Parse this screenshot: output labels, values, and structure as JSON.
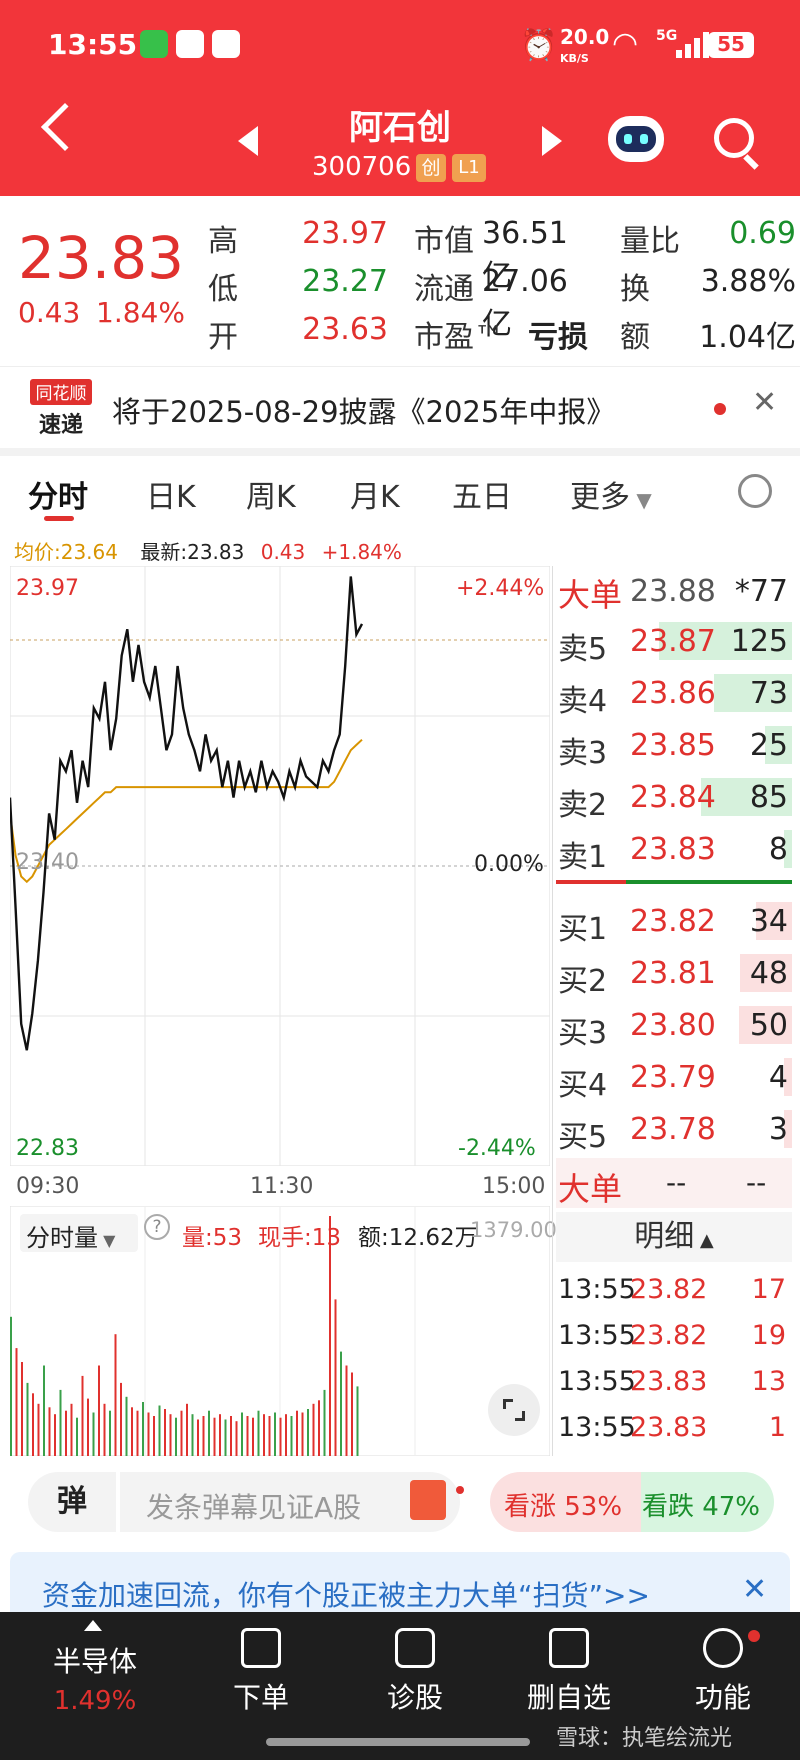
{
  "status_bar": {
    "time": "13:55",
    "net_speed": "20.0",
    "net_unit": "KB/S",
    "network": "5G",
    "battery": "55"
  },
  "header": {
    "stock_name": "阿石创",
    "stock_code": "300706",
    "board_badge": "创",
    "level_badge": "L1"
  },
  "quote": {
    "price": "23.83",
    "change": "0.43",
    "change_pct": "1.84%",
    "high_label": "高",
    "high": "23.97",
    "low_label": "低",
    "low": "23.27",
    "open_label": "开",
    "open": "23.63",
    "mcap_label": "市值",
    "mcap": "36.51亿",
    "float_label": "流通",
    "float": "27.06亿",
    "pe_label": "市盈™",
    "pe": "亏损",
    "vr_label": "量比",
    "vr": "0.69",
    "turn_label": "换",
    "turn": "3.88%",
    "amt_label": "额",
    "amt": "1.04亿"
  },
  "news": {
    "logo_line1": "同花顺",
    "logo_line2": "速递",
    "text": "将于2025-08-29披露《2025年中报》"
  },
  "tabs": [
    "分时",
    "日K",
    "周K",
    "月K",
    "五日",
    "更多"
  ],
  "legend": {
    "avg": "均价:23.64",
    "latest": "最新:23.83",
    "chg": "0.43",
    "pct": "+1.84%"
  },
  "axis": {
    "y_top": "23.97",
    "y_mid": "23.40",
    "y_bot": "22.83",
    "pct_top": "+2.44%",
    "pct_mid": "0.00%",
    "pct_bot": "-2.44%",
    "t_start": "09:30",
    "t_mid": "11:30",
    "t_end": "15:00"
  },
  "volume_info": {
    "selector": "分时量",
    "vol": "量:53",
    "now": "现手:13",
    "amt": "额:12.62万",
    "scale": "1379.00"
  },
  "orderbook": {
    "big_label": "大单",
    "big_price": "23.88",
    "big_qty": "*77",
    "asks": [
      {
        "label": "卖5",
        "price": "23.87",
        "qty": "125",
        "frac": 0.95
      },
      {
        "label": "卖4",
        "price": "23.86",
        "qty": "73",
        "frac": 0.56
      },
      {
        "label": "卖3",
        "price": "23.85",
        "qty": "25",
        "frac": 0.19
      },
      {
        "label": "卖2",
        "price": "23.84",
        "qty": "85",
        "frac": 0.65
      },
      {
        "label": "卖1",
        "price": "23.83",
        "qty": "8",
        "frac": 0.06
      }
    ],
    "bids": [
      {
        "label": "买1",
        "price": "23.82",
        "qty": "34",
        "frac": 0.26
      },
      {
        "label": "买2",
        "price": "23.81",
        "qty": "48",
        "frac": 0.37
      },
      {
        "label": "买3",
        "price": "23.80",
        "qty": "50",
        "frac": 0.38
      },
      {
        "label": "买4",
        "price": "23.79",
        "qty": "4",
        "frac": 0.03
      },
      {
        "label": "买5",
        "price": "23.78",
        "qty": "3",
        "frac": 0.02
      }
    ],
    "big2_label": "大单",
    "big2_a": "--",
    "big2_b": "--",
    "detail_label": "明细"
  },
  "ticks": [
    {
      "time": "13:55",
      "price": "23.82",
      "qty": "17"
    },
    {
      "time": "13:55",
      "price": "23.82",
      "qty": "19"
    },
    {
      "time": "13:55",
      "price": "23.83",
      "qty": "13"
    },
    {
      "time": "13:55",
      "price": "23.83",
      "qty": "1"
    }
  ],
  "danmu": {
    "icon": "弹",
    "placeholder": "发条弹幕见证A股",
    "up": "看涨 53%",
    "down": "看跌 47%",
    "up_frac": 0.53
  },
  "promo": {
    "text": "资金加速回流，你有个股正被主力大单“扫货”>>"
  },
  "bottom_nav": {
    "sector": "半导体",
    "sector_pct": "1.49%",
    "order": "下单",
    "diagnose": "诊股",
    "delete": "删自选",
    "func": "功能"
  },
  "watermark": "雪球：执笔绘流光",
  "chart_data": {
    "type": "line",
    "x_start": "09:30",
    "x_mid": "11:30",
    "x_end": "15:00",
    "ylim": [
      22.83,
      23.97
    ],
    "base": 23.4,
    "price_series": [
      23.53,
      23.32,
      23.1,
      23.05,
      23.12,
      23.22,
      23.35,
      23.5,
      23.45,
      23.6,
      23.58,
      23.62,
      23.52,
      23.6,
      23.55,
      23.7,
      23.68,
      23.75,
      23.62,
      23.68,
      23.8,
      23.85,
      23.75,
      23.82,
      23.75,
      23.72,
      23.78,
      23.7,
      23.62,
      23.65,
      23.78,
      23.7,
      23.65,
      23.62,
      23.58,
      23.65,
      23.6,
      23.62,
      23.55,
      23.6,
      23.53,
      23.6,
      23.55,
      23.58,
      23.54,
      23.6,
      23.55,
      23.58,
      23.56,
      23.53,
      23.58,
      23.55,
      23.6,
      23.57,
      23.56,
      23.55,
      23.6,
      23.58,
      23.62,
      23.65,
      23.78,
      23.95,
      23.84,
      23.86
    ],
    "avg_series": [
      23.5,
      23.42,
      23.38,
      23.37,
      23.38,
      23.4,
      23.42,
      23.44,
      23.45,
      23.46,
      23.47,
      23.48,
      23.49,
      23.5,
      23.51,
      23.52,
      23.53,
      23.54,
      23.54,
      23.55,
      23.55,
      23.55,
      23.55,
      23.55,
      23.55,
      23.55,
      23.55,
      23.55,
      23.55,
      23.55,
      23.55,
      23.55,
      23.55,
      23.55,
      23.55,
      23.55,
      23.55,
      23.55,
      23.55,
      23.55,
      23.55,
      23.55,
      23.55,
      23.55,
      23.55,
      23.55,
      23.55,
      23.55,
      23.55,
      23.55,
      23.55,
      23.55,
      23.55,
      23.55,
      23.55,
      23.55,
      23.55,
      23.55,
      23.56,
      23.58,
      23.6,
      23.62,
      23.63,
      23.64
    ],
    "volume": [
      800,
      620,
      540,
      420,
      360,
      300,
      520,
      280,
      240,
      380,
      260,
      300,
      220,
      460,
      330,
      250,
      520,
      300,
      260,
      700,
      420,
      340,
      280,
      260,
      310,
      250,
      230,
      290,
      270,
      240,
      220,
      260,
      300,
      240,
      210,
      230,
      260,
      220,
      240,
      210,
      230,
      200,
      250,
      230,
      220,
      260,
      240,
      230,
      250,
      220,
      240,
      230,
      260,
      250,
      270,
      300,
      320,
      380,
      1379,
      900,
      600,
      520,
      480,
      400
    ]
  }
}
